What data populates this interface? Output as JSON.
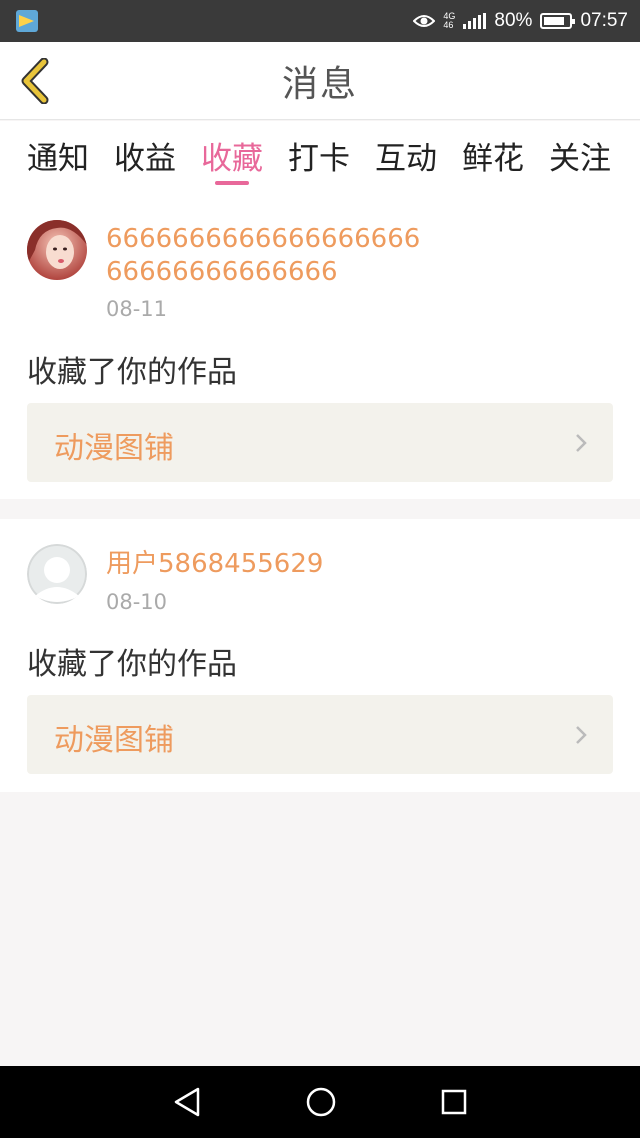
{
  "status_bar": {
    "network": "4G",
    "network_sub": "46",
    "battery": "80%",
    "time": "07:57"
  },
  "header": {
    "title": "消息"
  },
  "tabs": [
    {
      "label": "通知"
    },
    {
      "label": "收益"
    },
    {
      "label": "收藏",
      "active": true
    },
    {
      "label": "打卡"
    },
    {
      "label": "互动"
    },
    {
      "label": "鲜花"
    },
    {
      "label": "关注"
    }
  ],
  "messages": [
    {
      "username_line1": "6666666666666666666",
      "username_line2": "66666666666666",
      "date": "08-11",
      "action": "收藏了你的作品",
      "work_title": "动漫图铺"
    },
    {
      "username_line1": "用户5868455629",
      "date": "08-10",
      "action": "收藏了你的作品",
      "work_title": "动漫图铺"
    }
  ],
  "colors": {
    "accent": "#e8689a",
    "username": "#ee9b5e",
    "back_arrow": "#e8c43a"
  }
}
